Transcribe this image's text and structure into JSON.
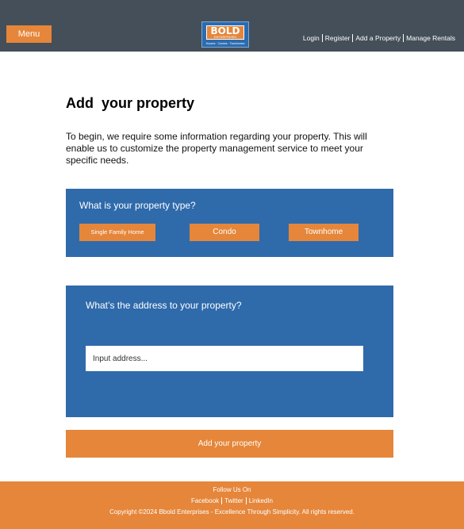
{
  "header": {
    "menu_label": "Menu",
    "logo": {
      "word": "BOLD",
      "sub": "ENTERPRISES",
      "tagline": "Houses · Condos · Townhomes"
    },
    "nav": [
      {
        "label": "Login"
      },
      {
        "label": "Register"
      },
      {
        "label": "Add a Property"
      },
      {
        "label": "Manage Rentals"
      }
    ]
  },
  "main": {
    "title": "Add  your property",
    "intro": "To begin, we require some information regarding your property. This will enable us to customize the property management service to meet your specific needs.",
    "property_type": {
      "question": "What is your property type?",
      "options": [
        {
          "label": "Single Family Home"
        },
        {
          "label": "Condo"
        },
        {
          "label": "Townhome"
        }
      ]
    },
    "address": {
      "question": "What’s the address to your property?",
      "placeholder": "Input address..."
    },
    "submit_label": "Add your property"
  },
  "footer": {
    "follow": "Follow Us On",
    "links": [
      {
        "label": "Facebook"
      },
      {
        "label": "Twitter"
      },
      {
        "label": "LinkedIn"
      }
    ],
    "copyright": "Copyright ©2024 Bbold Enterprises - Excellence Through Simplicity. All rights reserved."
  },
  "colors": {
    "header_bg": "#444f59",
    "accent_orange": "#e5863a",
    "card_blue": "#2f6aab"
  }
}
